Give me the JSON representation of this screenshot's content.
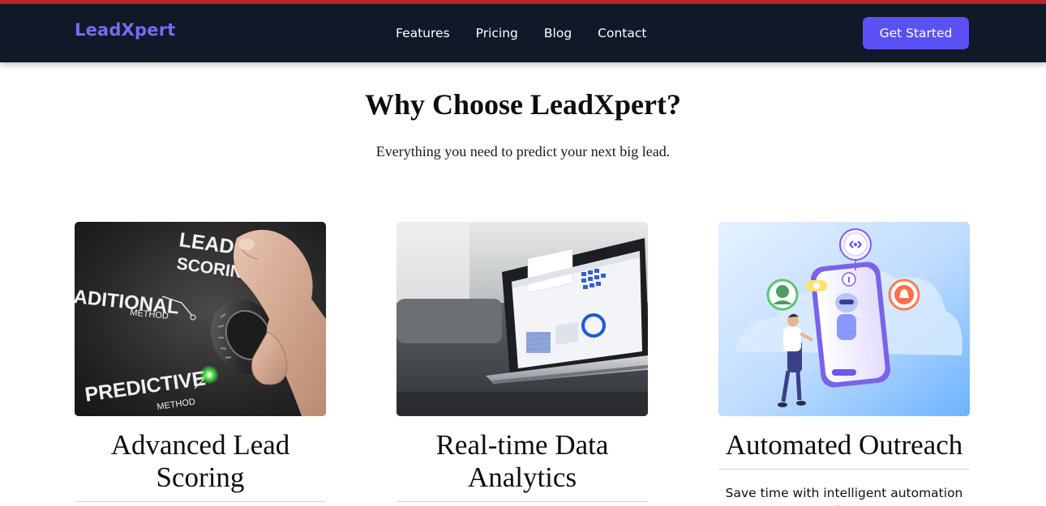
{
  "nav": {
    "brand": "LeadXpert",
    "links": [
      "Features",
      "Pricing",
      "Blog",
      "Contact"
    ],
    "cta_label": "Get Started"
  },
  "colors": {
    "top_strip": "#c0262b",
    "navbar_bg": "#111827",
    "brand": "#6f6ff5",
    "cta_bg": "#5b50f5"
  },
  "section": {
    "title": "Why Choose LeadXpert?",
    "subtitle": "Everything you need to predict your next big lead."
  },
  "cards": [
    {
      "image_icon": "lead-scoring-dial-photo",
      "image_text": [
        "LEAD",
        "SCORING",
        "ADITIONAL",
        "METHOD",
        "PREDICTIVE",
        "METHOD"
      ],
      "title": "Advanced Lead Scoring",
      "desc": ""
    },
    {
      "image_icon": "laptop-analytics-photo",
      "title": "Real-time Data Analytics",
      "desc": ""
    },
    {
      "image_icon": "chatbot-automation-illustration",
      "title": "Automated Outreach",
      "desc": "Save time with intelligent automation that"
    }
  ]
}
